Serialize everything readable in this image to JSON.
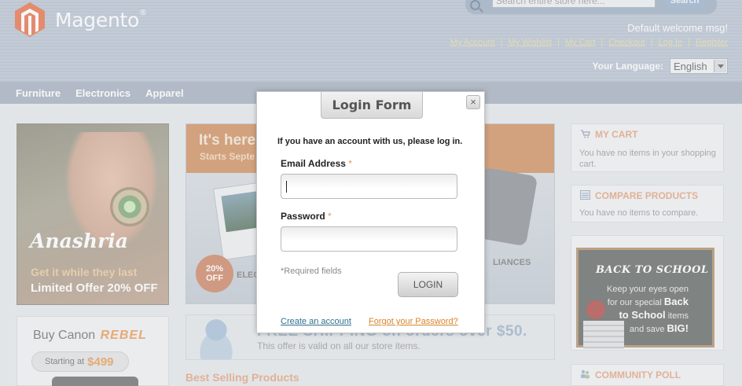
{
  "header": {
    "logo_text": "Magento",
    "logo_mark": "®",
    "search_placeholder": "Search entire store here...",
    "search_button": "Search",
    "welcome": "Default welcome msg!",
    "links": [
      "My Account",
      "My Wishlist",
      "My Cart",
      "Checkout",
      "Log In",
      "Register"
    ],
    "language_label": "Your Language:",
    "language_value": "English"
  },
  "nav": {
    "items": [
      "Furniture",
      "Electronics",
      "Apparel"
    ]
  },
  "left_column": {
    "promo": {
      "title": "Anashria",
      "line1": "Get it while they last",
      "line2": "Limited Offer 20% OFF"
    },
    "canon": {
      "title": "Buy Canon",
      "title_accent": "REBEL",
      "starting_label": "Starting at",
      "price": "$499"
    }
  },
  "center_column": {
    "banner": {
      "headline": "It's here",
      "subline": "Starts Septe",
      "badge_line1": "20%",
      "badge_line2": "OFF",
      "label_left": "ELEC",
      "label_right": "LIANCES"
    },
    "shipping": {
      "headline": "FREE SHIPPING on orders over $50.",
      "subline": "This offer is valid on all our store items."
    },
    "best_selling": "Best Selling Products"
  },
  "right_column": {
    "cart": {
      "title": "MY CART",
      "text": "You have no items in your shopping cart."
    },
    "compare": {
      "title": "COMPARE PRODUCTS",
      "text": "You have no items to compare."
    },
    "school": {
      "title": "BACK TO SCHOOL",
      "line1": "Keep your eyes open",
      "line2": "for our special",
      "bold1": "Back",
      "line3": "to School",
      "line3b": "items",
      "line4": "and save",
      "bold2": "BIG!"
    },
    "poll": {
      "title": "COMMUNITY POLL"
    }
  },
  "modal": {
    "title": "Login Form",
    "close": "×",
    "intro": "If you have an account with us, please log in.",
    "email_label": "Email Address",
    "password_label": "Password",
    "required_mark": "*",
    "required_note": "*Required fields",
    "login_button": "LOGIN",
    "create_link": "Create an account",
    "forgot_link": "Forgot your Password?"
  }
}
